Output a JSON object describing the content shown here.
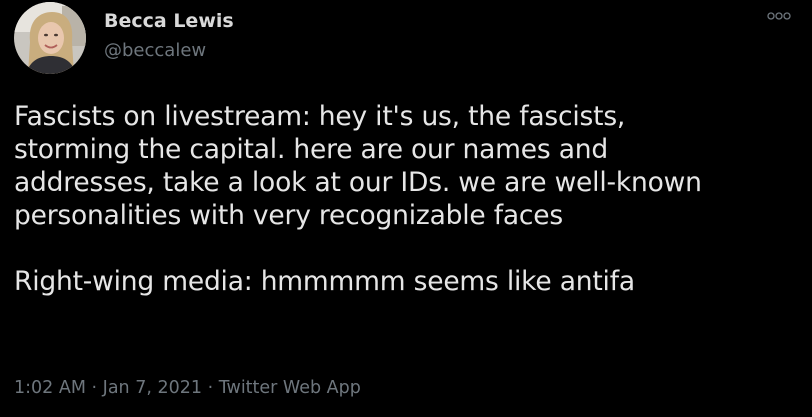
{
  "author": {
    "display_name": "Becca Lewis",
    "handle": "@beccalew"
  },
  "tweet": {
    "lines": [
      "Fascists on livestream: hey it's us, the fascists,",
      "storming the capital. here are our names and",
      "addresses, take a look at our IDs. we are well-known",
      "personalities with very recognizable faces",
      "Right-wing media: hmmmmm seems like antifa"
    ]
  },
  "meta": {
    "time": "1:02 AM",
    "separator": "·",
    "date": "Jan 7, 2021",
    "source": "Twitter Web App"
  },
  "icons": {
    "more": "more-options-icon"
  },
  "colors": {
    "background": "#000000",
    "text": "#d9d9d9",
    "secondary": "#6e767d"
  }
}
